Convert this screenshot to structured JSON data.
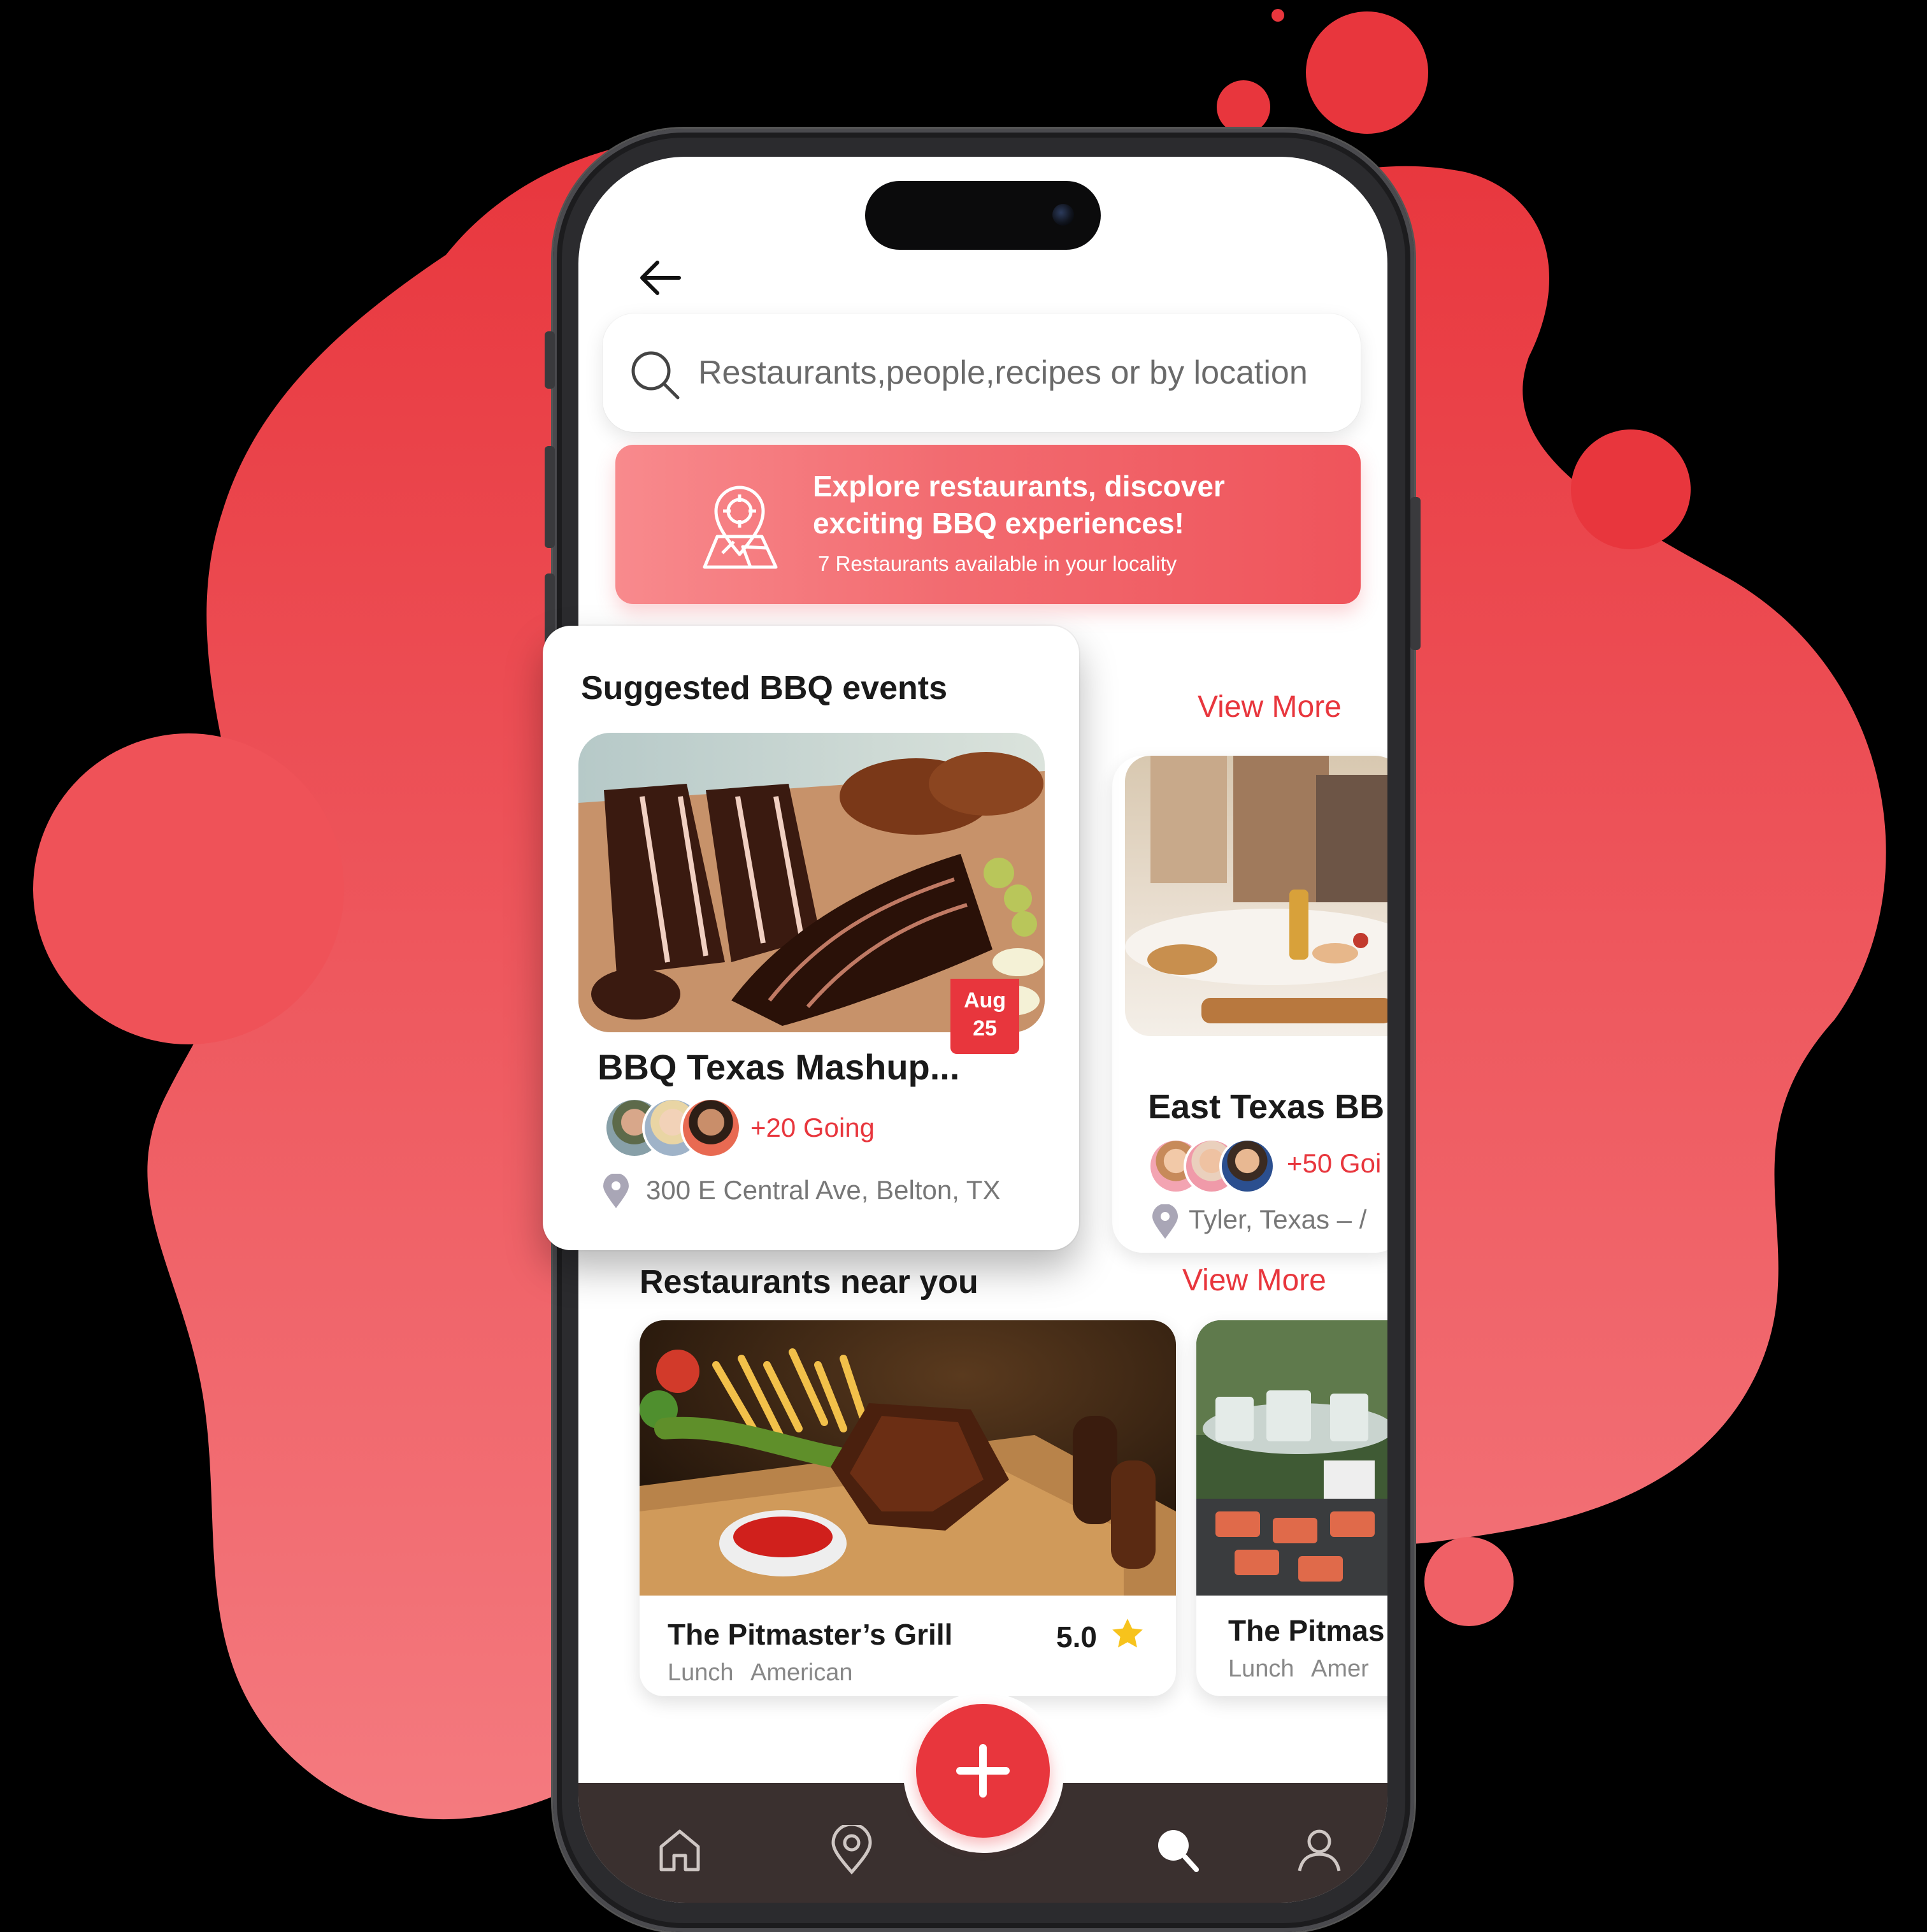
{
  "search": {
    "placeholder": "Restaurants,people,recipes or by location"
  },
  "banner": {
    "title": "Explore restaurants, discover exciting BBQ experiences!",
    "subtitle": "7 Restaurants available in your locality"
  },
  "events_section": {
    "title": "Suggested BBQ events",
    "view_more": "View More",
    "cards": [
      {
        "name": "BBQ Texas Mashup...",
        "date_month": "Aug",
        "date_day": "25",
        "going": "+20 Going",
        "location": "300 E Central Ave, Belton, TX"
      },
      {
        "name": "East Texas BB",
        "going": "+50 Goi",
        "location": "Tyler, Texas – /"
      }
    ]
  },
  "restaurants_section": {
    "title": "Restaurants near you",
    "view_more": "View More",
    "cards": [
      {
        "name": "The Pitmaster’s Grill",
        "tags": "Lunch American",
        "rating": "5.0"
      },
      {
        "name": "The Pitmas",
        "tags": "Lunch Amer"
      }
    ]
  },
  "nav": {
    "items": [
      "home-icon",
      "location-icon",
      "add-icon",
      "search-icon",
      "profile-icon"
    ],
    "active": "search-icon"
  },
  "colors": {
    "accent": "#e8363d",
    "banner": "#f26b70",
    "nav_bg": "#3a302f",
    "blob": "#ef5258"
  }
}
